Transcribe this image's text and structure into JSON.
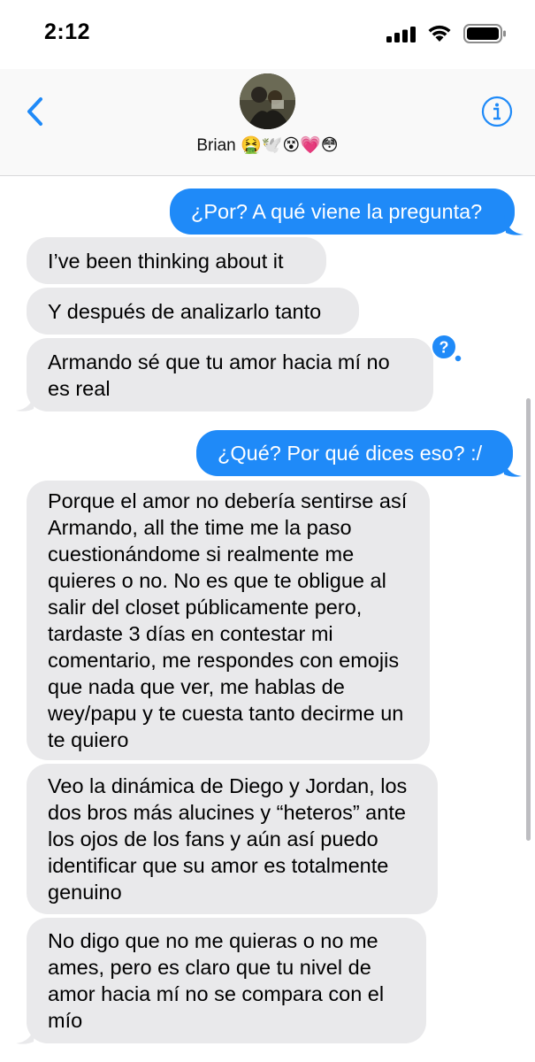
{
  "status_bar": {
    "time": "2:12"
  },
  "header": {
    "contact_name": "Brian 🤮🕊️😵💗😳"
  },
  "messages": [
    {
      "from": "me",
      "text": "¿Por? A qué viene la pregunta?"
    },
    {
      "from": "them",
      "text": "I’ve been thinking about it"
    },
    {
      "from": "them",
      "text": "Y después de analizarlo tanto"
    },
    {
      "from": "them",
      "text": "Armando sé que tu amor hacia mí no es real",
      "reaction": "?"
    },
    {
      "from": "me",
      "text": "¿Qué? Por qué dices eso? :/"
    },
    {
      "from": "them",
      "text": "Porque el amor no debería sentirse así Armando, all the time me la paso cuestionándome si realmente me quieres o no. No es que te obligue al salir del closet públicamente pero, tardaste 3 días en contestar mi comentario, me respondes con emojis que nada que ver, me hablas de wey/papu y te cuesta tanto decirme un te quiero"
    },
    {
      "from": "them",
      "text": "Veo la dinámica de Diego y Jordan, los dos bros más alucines y “heteros” ante los ojos de los fans y aún así puedo identificar que su amor es totalmente genuino"
    },
    {
      "from": "them",
      "text": "No digo que no me quieras o no me ames, pero es claro que tu nivel de amor hacia mí no se compara con el mío"
    }
  ]
}
